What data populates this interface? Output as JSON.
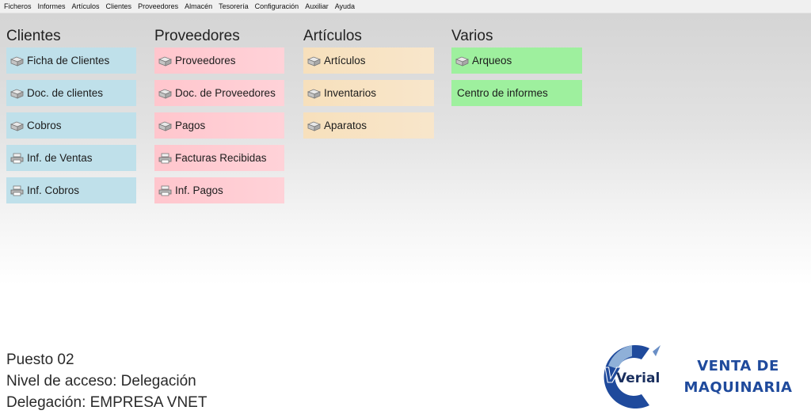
{
  "menubar": {
    "items": [
      "Ficheros",
      "Informes",
      "Artículos",
      "Clientes",
      "Proveedores",
      "Almacén",
      "Tesorería",
      "Configuración",
      "Auxiliar",
      "Ayuda"
    ]
  },
  "columns": [
    {
      "title": "Clientes",
      "color": "#bfe0ea",
      "tiles": [
        {
          "label": "Ficha de Clientes",
          "icon": "box-icon"
        },
        {
          "label": "Doc. de clientes",
          "icon": "box-icon"
        },
        {
          "label": "Cobros",
          "icon": "box-icon"
        },
        {
          "label": "Inf. de Ventas",
          "icon": "printer-icon"
        },
        {
          "label": "Inf. Cobros",
          "icon": "printer-icon"
        }
      ]
    },
    {
      "title": "Proveedores",
      "color": "#ffc6cd",
      "tiles": [
        {
          "label": "Proveedores",
          "icon": "box-icon"
        },
        {
          "label": "Doc. de Proveedores",
          "icon": "box-icon"
        },
        {
          "label": "Pagos",
          "icon": "box-icon"
        },
        {
          "label": "Facturas Recibidas",
          "icon": "printer-icon"
        },
        {
          "label": "Inf. Pagos",
          "icon": "printer-icon"
        }
      ]
    },
    {
      "title": "Artículos",
      "color": "#f7e0bc",
      "tiles": [
        {
          "label": "Artículos",
          "icon": "box-icon"
        },
        {
          "label": "Inventarios",
          "icon": "box-icon"
        },
        {
          "label": "Aparatos",
          "icon": "box-icon"
        }
      ]
    },
    {
      "title": "Varios",
      "color": "#9ef09e",
      "tiles": [
        {
          "label": "Arqueos",
          "icon": "box-icon"
        },
        {
          "label": "Centro de informes",
          "icon": ""
        }
      ]
    }
  ],
  "info": {
    "puesto": "Puesto 02",
    "nivel": "Nivel de acceso: Delegación",
    "delegacion": "Delegación: EMPRESA VNET"
  },
  "logo": {
    "text": "Verial"
  },
  "brand": {
    "line1": "VENTA DE",
    "line2": "MAQUINARIA"
  }
}
